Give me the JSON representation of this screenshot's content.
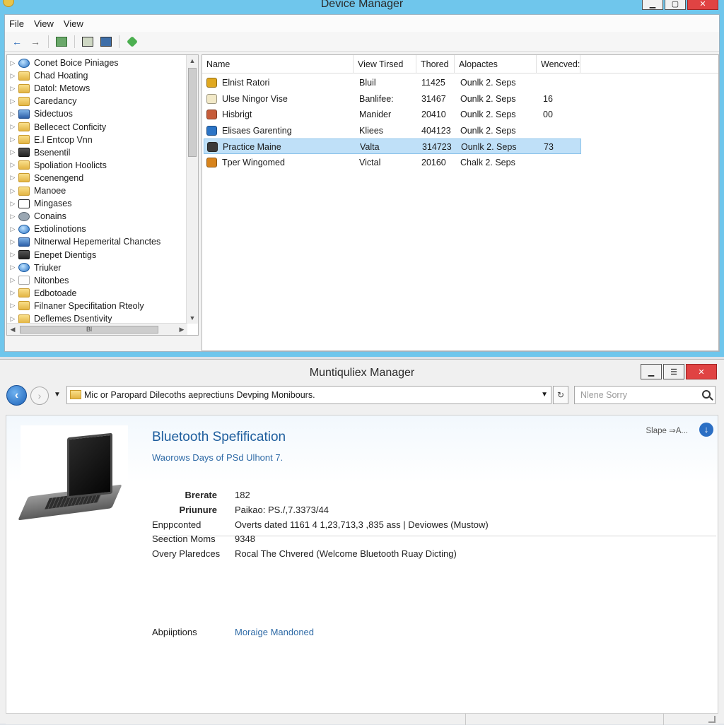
{
  "device_manager": {
    "title": "Device Manager",
    "menu": [
      "File",
      "View",
      "View"
    ],
    "toolbar_icons": [
      "back-arrow-icon",
      "forward-arrow-icon",
      "properties-icon",
      "update-icon",
      "monitor-icon",
      "scan-hardware-icon"
    ],
    "tree": [
      {
        "label": "Conet Boice Piniages",
        "icon": "globe"
      },
      {
        "label": "Chad Hoating",
        "icon": "folder"
      },
      {
        "label": "Datol: Metows",
        "icon": "folder"
      },
      {
        "label": "Caredancy",
        "icon": "folder"
      },
      {
        "label": "Sidectuos",
        "icon": "blue"
      },
      {
        "label": "Bellecect Conficity",
        "icon": "folder"
      },
      {
        "label": "E.l Entcop Vnn",
        "icon": "folder"
      },
      {
        "label": "Bsenentil",
        "icon": "dark"
      },
      {
        "label": "Spoliation Hoolicts",
        "icon": "folder"
      },
      {
        "label": "Scenengend",
        "icon": "folder"
      },
      {
        "label": "Manoee",
        "icon": "folder"
      },
      {
        "label": "Mingases",
        "icon": "monitor"
      },
      {
        "label": "Conains",
        "icon": "gear"
      },
      {
        "label": "Extiolinotions",
        "icon": "globe"
      },
      {
        "label": "Nitnerwal Hepemerital Chanctes",
        "icon": "blue"
      },
      {
        "label": "Enepet Dientigs",
        "icon": "dark"
      },
      {
        "label": "Triuker",
        "icon": "globe"
      },
      {
        "label": "Nitonbes",
        "icon": "white"
      },
      {
        "label": "Edbotoade",
        "icon": "folder"
      },
      {
        "label": "Filnaner Specifitation Rteoly",
        "icon": "folder"
      },
      {
        "label": "Deflemes Dsentivity",
        "icon": "folder"
      }
    ],
    "tree_hscroll_label": "Bl",
    "columns": [
      "Name",
      "View Tirsed",
      "Thored",
      "Alopactes",
      "Wencved:"
    ],
    "rows": [
      {
        "name": "Elnist Ratori",
        "view": "Bluil",
        "thored": "11425",
        "alopactes": "Ounlk 2. Seps",
        "wencved": "",
        "icon_color": "#e0a820",
        "selected": false
      },
      {
        "name": "Ulse Ningor Vise",
        "view": "Banlifee:",
        "thored": "31467",
        "alopactes": "Ounlk 2. Seps",
        "wencved": "16",
        "icon_color": "#f2e9c8",
        "selected": false
      },
      {
        "name": "Hisbrigt",
        "view": "Manider",
        "thored": "20410",
        "alopactes": "Ounlk 2. Seps",
        "wencved": "00",
        "icon_color": "#c65c3a",
        "selected": false
      },
      {
        "name": "Elisaes Garenting",
        "view": "Kliees",
        "thored": "404123",
        "alopactes": "Ounlk 2. Seps",
        "wencved": "",
        "icon_color": "#2b74c6",
        "selected": false
      },
      {
        "name": "Practice Maine",
        "view": "Valta",
        "thored": "314723",
        "alopactes": "Ounlk 2. Seps",
        "wencved": "73",
        "icon_color": "#3b3b3b",
        "selected": true
      },
      {
        "name": "Tper Wingomed",
        "view": "Victal",
        "thored": "20160",
        "alopactes": "Chalk 2. Seps",
        "wencved": "",
        "icon_color": "#d8841c",
        "selected": false
      }
    ]
  },
  "muntiquliex_manager": {
    "title": "Muntiquliex Manager",
    "address": "Mic or Paropard Dilecoths aeprectiuns Devping Monibours.",
    "search_placeholder": "Nlene Sorry",
    "sort_label": "Slape ⇒A...",
    "heading": "Bluetooth Spefification",
    "subheading": "Waorows Days of PSd Ulhont 7.",
    "properties": [
      {
        "label": "Brerate",
        "value": "182",
        "bold": true
      },
      {
        "label": "Priunure",
        "value": "Paikao: PS./,7.3373/44",
        "bold": true
      },
      {
        "label": "Enppconted",
        "value": "Overts dated 1161 4 1,23,713,3 ,835 ass | Deviowes (Mustow)",
        "bold": false
      },
      {
        "label": "Seection Moms",
        "value": "9348",
        "bold": false
      },
      {
        "label": "Overy Plaredces",
        "value": "Rocal The Chvered (Welcome Bluetooth Ruay Dicting)",
        "bold": false
      }
    ],
    "applications_label": "Abpiiptions",
    "applications_link": "Moraige Mandoned"
  },
  "colors": {
    "title_bar_blue": "#6fc6ec",
    "selection": "#bfe0f8",
    "link_blue": "#2e6aa6",
    "close_red": "#e04343"
  }
}
